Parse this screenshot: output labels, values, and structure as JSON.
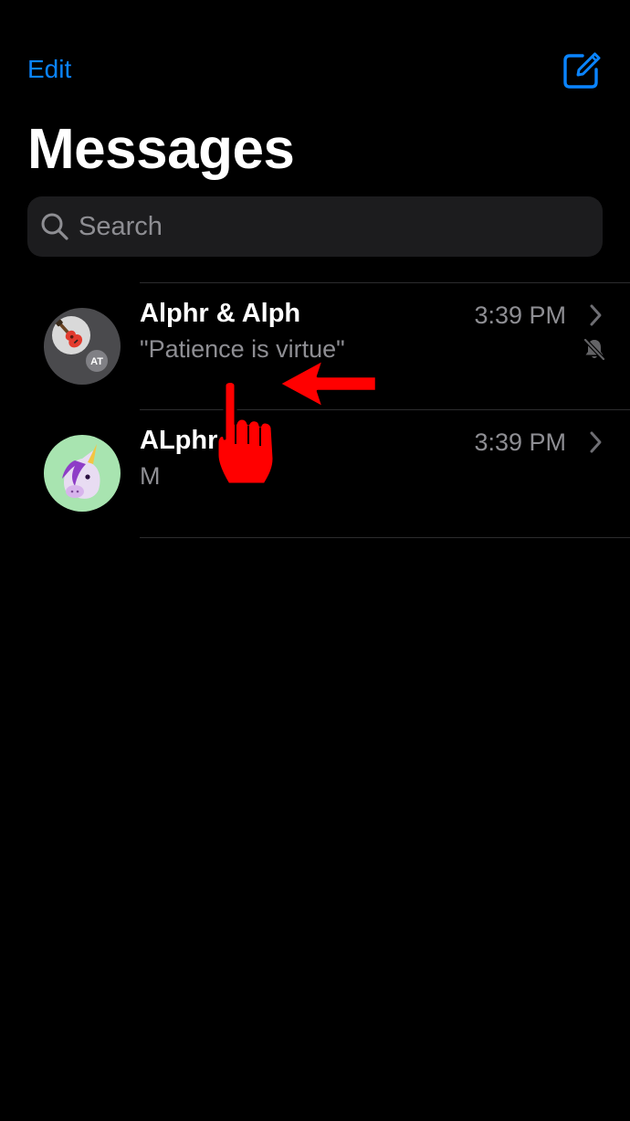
{
  "nav": {
    "edit_label": "Edit"
  },
  "title": "Messages",
  "search": {
    "placeholder": "Search"
  },
  "conversations": [
    {
      "name": "Alphr & Alph",
      "time": "3:39 PM",
      "preview": "\"Patience is virtue\"",
      "muted": true,
      "avatar_icon": "guitar-icon",
      "avatar_badge": "AT"
    },
    {
      "name": "ALphr",
      "time": "3:39 PM",
      "preview": "M",
      "muted": false,
      "avatar_icon": "unicorn-icon"
    }
  ],
  "colors": {
    "accent": "#0a84ff",
    "background": "#000000",
    "secondary_text": "#8e8e93",
    "annotation": "#ff0000"
  },
  "annotations": {
    "pointer": "hand-pointer-icon",
    "arrow": "left-arrow-icon"
  }
}
